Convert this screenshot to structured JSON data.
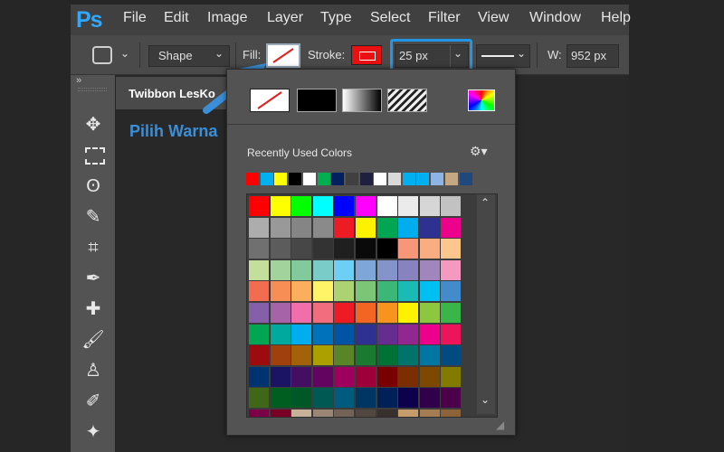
{
  "app": {
    "logo": "Ps"
  },
  "menu": [
    "File",
    "Edit",
    "Image",
    "Layer",
    "Type",
    "Select",
    "Filter",
    "View",
    "Window",
    "Help"
  ],
  "options": {
    "tool_mode": "Shape",
    "fill_label": "Fill:",
    "stroke_label": "Stroke:",
    "stroke_width": "25 px",
    "width_label": "W:",
    "width_value": "952 px"
  },
  "document": {
    "tab_title": "Twibbon LesKo"
  },
  "annotation": {
    "text": "Pilih Warna",
    "color": "#3a8fd8"
  },
  "popup": {
    "section_title": "Recently Used Colors",
    "recent_colors": [
      "#ff0000",
      "#00b0f0",
      "#ffff00",
      "#000000",
      "#ffffff",
      "#00b050",
      "#002060",
      "#404040",
      "#1f1f3f",
      "#ffffff",
      "#d9d9d9",
      "#00b0f0",
      "#00b0f0",
      "#8db4e2",
      "#c4a882",
      "#1f497d"
    ],
    "grid_rows": [
      [
        "#ff0000",
        "#ffff00",
        "#00ff00",
        "#00ffff",
        "#0000ff",
        "#ff00ff",
        "#ffffff",
        "#ebebeb",
        "#d6d6d6",
        "#c2c2c2"
      ],
      [
        "#adadad",
        "#999999",
        "#858585",
        "#8a8a8a",
        "#ed1c24",
        "#fff200",
        "#00a651",
        "#00aeef",
        "#2e3192",
        "#ec008c"
      ],
      [
        "#707070",
        "#5c5c5c",
        "#474747",
        "#333333",
        "#1f1f1f",
        "#0a0a0a",
        "#000000",
        "#f7977a",
        "#fbad82",
        "#fdc68c"
      ],
      [
        "#c4df9b",
        "#a3d39c",
        "#82ca9c",
        "#7accc8",
        "#6dcff6",
        "#7ea7d8",
        "#8493ca",
        "#8882be",
        "#a186be",
        "#f49ac1"
      ],
      [
        "#f26c4f",
        "#f68e55",
        "#fbaf5c",
        "#fff467",
        "#acd372",
        "#7cc576",
        "#3bb878",
        "#1abbb4",
        "#00bff3",
        "#438ccb"
      ],
      [
        "#8560a8",
        "#a763a8",
        "#f06eaa",
        "#f26d7d",
        "#ed1c24",
        "#f26522",
        "#f7941d",
        "#fff200",
        "#8dc63f",
        "#39b54a"
      ],
      [
        "#00a651",
        "#00a99d",
        "#00aeef",
        "#0072bc",
        "#0054a6",
        "#2e3192",
        "#662d91",
        "#92278f",
        "#ec008c",
        "#ed145b"
      ],
      [
        "#9e0b0f",
        "#a0410d",
        "#a3620a",
        "#aba000",
        "#598527",
        "#1a7b30",
        "#007236",
        "#00746b",
        "#0076a3",
        "#004b80"
      ],
      [
        "#003471",
        "#1b1464",
        "#440e62",
        "#630460",
        "#9e005d",
        "#9e0039",
        "#790000",
        "#7b2e00",
        "#7d4900",
        "#827b00"
      ],
      [
        "#406618",
        "#005e20",
        "#005826",
        "#005952",
        "#005b7f",
        "#003663",
        "#002157",
        "#0d004c",
        "#32004b",
        "#4b0049"
      ],
      [
        "#7b0046",
        "#7a0026",
        "#c7b299",
        "#998675",
        "#736357",
        "#534741",
        "#37302d",
        "#c69c6d",
        "#a67c52",
        "#8c6239"
      ]
    ]
  }
}
